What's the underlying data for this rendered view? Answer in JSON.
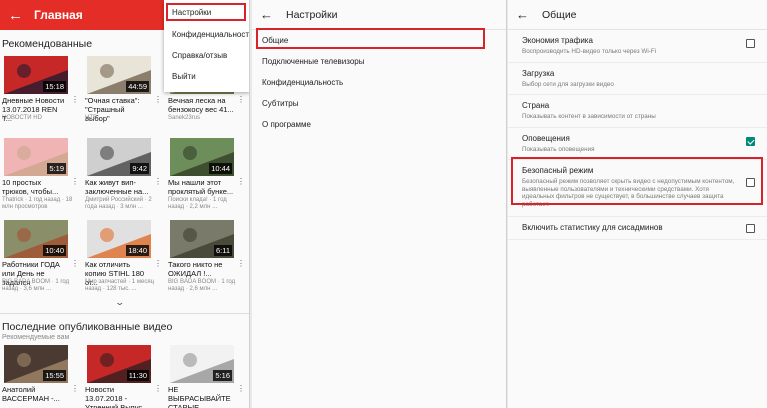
{
  "panel1": {
    "title": "Главная",
    "back_icon": "arrow-left-icon",
    "section_recommended": "Рекомендованные",
    "videos": [
      {
        "title": "Дневные Новости 13.07.2018 REN T...",
        "sub": "НОВОСТИ HD",
        "duration": "15:18",
        "colors": [
          "#c62828",
          "#1a1a2e"
        ]
      },
      {
        "title": "\"Очная ставка\": \"Страшный выбор\"",
        "sub": "НТВ",
        "duration": "44:59",
        "colors": [
          "#e8e4d8",
          "#6e5c48"
        ]
      },
      {
        "title": "Вечная леска на бензокосу вес 41...",
        "sub": "Sanek23rus",
        "duration": "",
        "colors": [
          "#b7a98a",
          "#5d6b3a"
        ]
      },
      {
        "title": "",
        "sub": "1 ... назад · 72 тыс. п...",
        "duration": "",
        "colors": [],
        "sub_only": true
      },
      {
        "title": "",
        "sub": "1 месяц назад · 67 тыс. ...",
        "duration": "",
        "colors": [],
        "sub_only": true
      },
      {
        "title": "",
        "sub": "5 месяцев назад · 4,6 млн ...",
        "duration": "",
        "colors": [],
        "sub_only": true
      },
      {
        "title": "10 простых трюков, чтобы...",
        "sub": "Thatrick · 1 год назад · 18 млн просмотров",
        "duration": "5:19",
        "colors": [
          "#f0b4b4",
          "#c9a68a"
        ]
      },
      {
        "title": "Как живут вип-заключенные на...",
        "sub": "Дмитрий Российский · 2 года назад · 3 млн ...",
        "duration": "9:42",
        "colors": [
          "#cfcfcf",
          "#3d3d3d"
        ]
      },
      {
        "title": "Мы нашли этот проклятый бунке...",
        "sub": "Поиски клада! · 1 год назад · 2,2 млн ...",
        "duration": "10:44",
        "colors": [
          "#6d8d5a",
          "#2d3b22"
        ]
      },
      {
        "title": "Работники ГОДА или День не задался",
        "sub": "BIG BADA BOOM · 1 год назад · 3,6 млн ...",
        "duration": "10:40",
        "colors": [
          "#8a8f6a",
          "#a54b2b"
        ]
      },
      {
        "title": "Как отличить копию STIHL 180 от...",
        "sub": "Мир запчастей · 1 месяц назад · 128 тыс. ...",
        "duration": "18:40",
        "colors": [
          "#e0e0e0",
          "#e0661f"
        ]
      },
      {
        "title": "Такого никто не ОЖИДАЛ !...",
        "sub": "BIG BADA BOOM · 1 год назад · 2,6 млн ...",
        "duration": "6:11",
        "colors": [
          "#7a7a6a",
          "#3b3b2b"
        ]
      }
    ],
    "more_icon": "chevron-down-icon",
    "section_latest": "Последние опубликованные видео",
    "section_latest_sub": "Рекомендуемые вам",
    "latest": [
      {
        "title": "Анатолий ВАССЕРМАН -...",
        "duration": "15:55",
        "colors": [
          "#4a3a32",
          "#a88c6e"
        ]
      },
      {
        "title": "Новости 13.07.2018 - Утренний Выпус...",
        "duration": "11:30",
        "colors": [
          "#c62828",
          "#2a1e1e"
        ]
      },
      {
        "title": "НЕ ВЫБРАСЫВАЙТЕ СТАРЫЕ...",
        "duration": "5:16",
        "colors": [
          "#f2f2f2",
          "#8d8d8d"
        ]
      }
    ],
    "menu": [
      "Настройки",
      "Конфиденциальность",
      "Справка/отзыв",
      "Выйти"
    ]
  },
  "panel2": {
    "title": "Настройки",
    "items": [
      "Общие",
      "Подключенные телевизоры",
      "Конфиденциальность",
      "Субтитры",
      "О программе"
    ]
  },
  "panel3": {
    "title": "Общие",
    "settings": [
      {
        "title": "Экономия трафика",
        "sub": "Воспроизводить HD-видео только через Wi-Fi",
        "checked": false
      },
      {
        "title": "Загрузка",
        "sub": "Выбор сети для загрузки видео",
        "checked": null
      },
      {
        "title": "Страна",
        "sub": "Показывать контент в зависимости от страны",
        "checked": null
      },
      {
        "title": "Оповещения",
        "sub": "Показывать оповещения",
        "checked": true
      },
      {
        "title": "Безопасный режим",
        "sub": "Безопасный режим позволяет скрыть видео с недопустимым контентом, выявленные пользователями и техническими средствами. Хотя идеальных фильтров не существует, в большинстве случаев защита работает.",
        "checked": false
      },
      {
        "title": "Включить статистику для сисадминов",
        "sub": "",
        "checked": false
      }
    ]
  },
  "colors": {
    "brand_red": "#e52d27",
    "highlight": "#d8232a",
    "teal": "#00897b"
  }
}
